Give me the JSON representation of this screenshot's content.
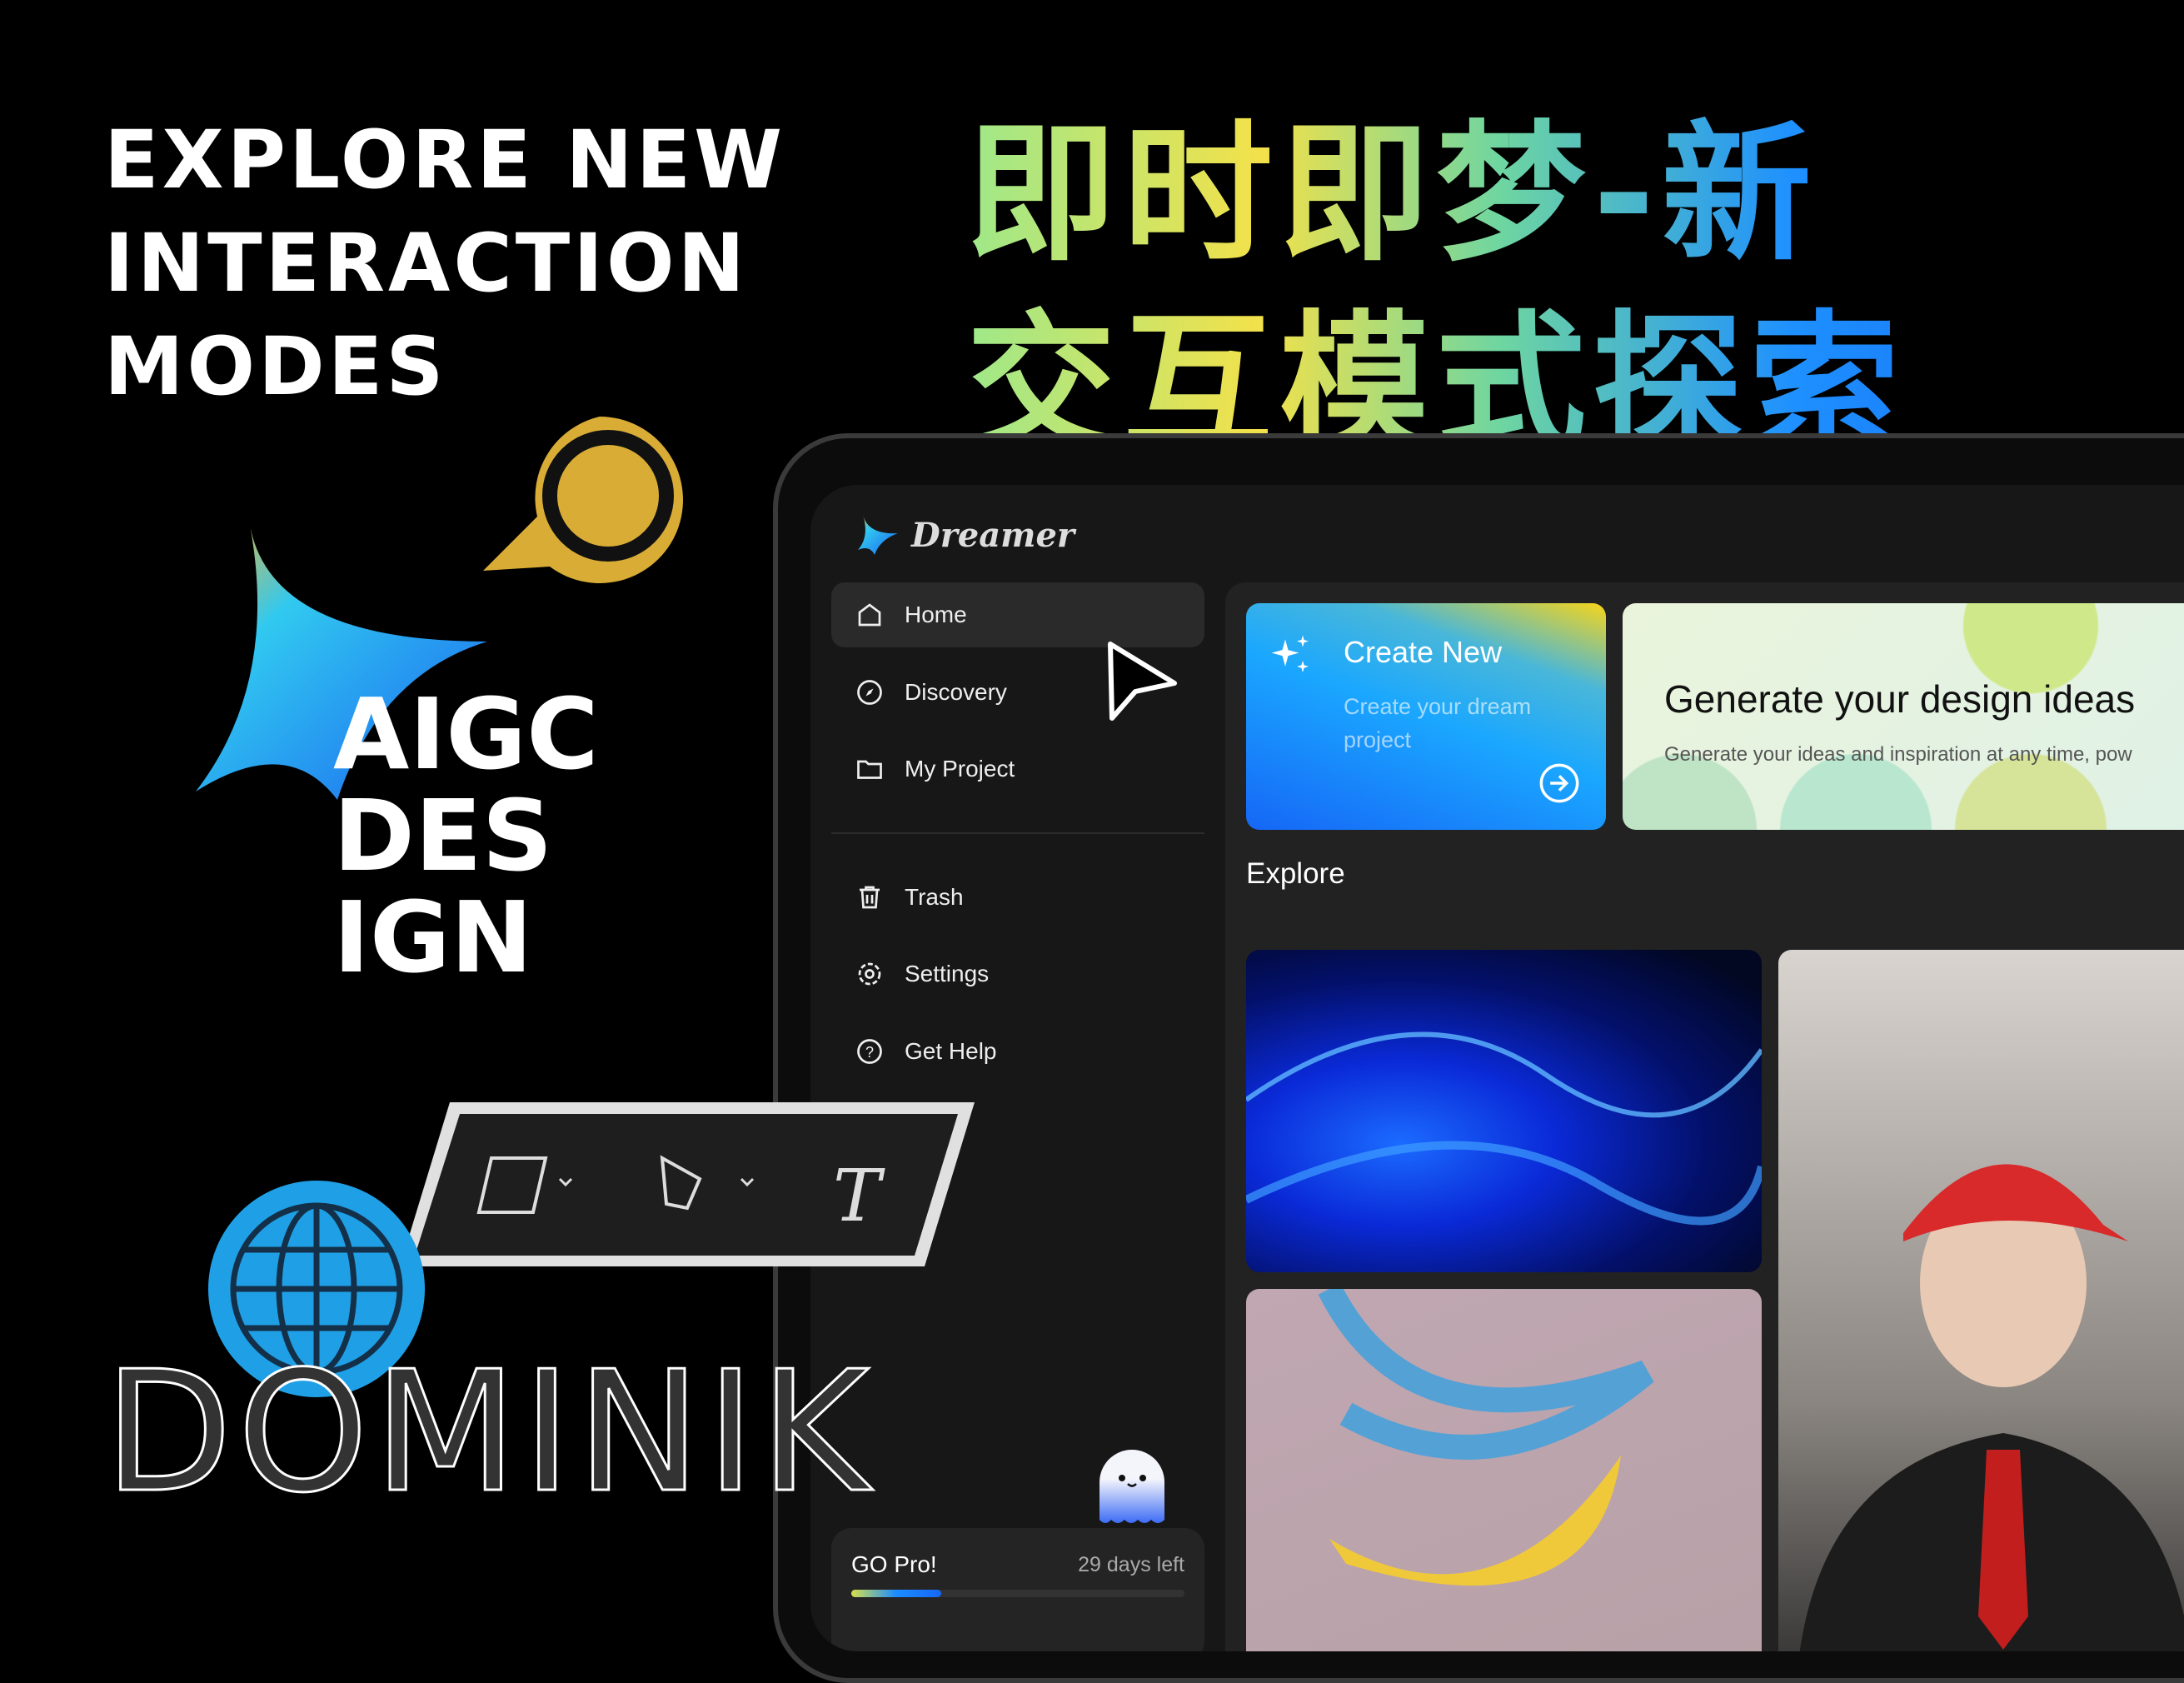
{
  "poster": {
    "en_title": [
      "EXPLORE NEW",
      "INTERACTION",
      "MODES"
    ],
    "cn_title": [
      "即时即梦-新",
      "交互模式探索"
    ],
    "badge_text": [
      "AIGC",
      "DES",
      "IGN"
    ],
    "outline_name": "DOMINIK"
  },
  "app": {
    "brand": "Dreamer",
    "sidebar": {
      "items": [
        {
          "label": "Home",
          "icon": "home-icon",
          "active": true
        },
        {
          "label": "Discovery",
          "icon": "compass-icon"
        },
        {
          "label": "My Project",
          "icon": "folder-icon"
        }
      ],
      "secondary": [
        {
          "label": "Trash",
          "icon": "trash-icon"
        },
        {
          "label": "Settings",
          "icon": "gear-icon"
        },
        {
          "label": "Get Help",
          "icon": "help-icon"
        }
      ],
      "pro": {
        "title": "GO Pro!",
        "days_left": "29 days left",
        "progress_percent": 27
      }
    },
    "create_card": {
      "title": "Create New",
      "subtitle": "Create your dream project"
    },
    "generate_card": {
      "title": "Generate your design ideas",
      "subtitle": "Generate your ideas and inspiration at any time, pow"
    },
    "explore": {
      "heading": "Explore"
    },
    "colors": {
      "accent": "#1667f6",
      "bg": "#171717",
      "panel": "#222222"
    }
  }
}
